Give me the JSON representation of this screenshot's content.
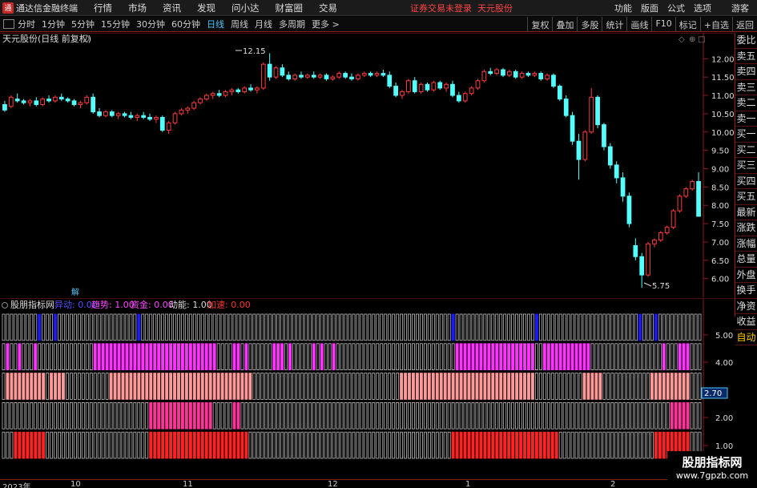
{
  "menubar": {
    "app_title": "通达信金融终端",
    "menus": [
      "行情",
      "市场",
      "资讯",
      "发现",
      "问小达",
      "财富圈",
      "交易"
    ],
    "login_status": "证券交易未登录",
    "stock_name_red": "天元股份",
    "right_menus": [
      "功能",
      "版面",
      "公式",
      "选项"
    ],
    "guest": "游客"
  },
  "periodbar": {
    "periods": [
      "分时",
      "1分钟",
      "5分钟",
      "15分钟",
      "30分钟",
      "60分钟",
      "日线",
      "周线",
      "月线",
      "多周期",
      "更多 >"
    ],
    "active_period": "日线",
    "tools": [
      "复权",
      "叠加",
      "多股",
      "统计",
      "画线",
      "F10",
      "标记",
      "+自选",
      "返回"
    ]
  },
  "main_chart": {
    "title": "天元股份(日线 前复权)",
    "annot_high": "12.15",
    "annot_low": "5.75",
    "marker": "解",
    "y_ticks": [
      "12.00",
      "11.50",
      "11.00",
      "10.50",
      "10.00",
      "9.50",
      "9.00",
      "8.50",
      "8.00",
      "7.50",
      "7.00",
      "6.50",
      "6.00"
    ]
  },
  "sub_chart": {
    "name": "股朋指标网",
    "params": [
      {
        "label": "异动: 0.00",
        "color": "#5050ff"
      },
      {
        "label": "趋势: 1.00",
        "color": "#ff44ff"
      },
      {
        "label": "资金: 0.00",
        "color": "#ff44ff"
      },
      {
        "label": "动能: 1.00",
        "color": "#dddddd"
      },
      {
        "label": "加速: 0.00",
        "color": "#ff3333"
      }
    ],
    "y_ticks": [
      "5.00",
      "4.00",
      "2.00",
      "1.00"
    ],
    "current_value": "2.70"
  },
  "date_axis": [
    "2023年",
    "10",
    "11",
    "12",
    "1",
    "2"
  ],
  "side_panel": [
    "委比",
    "卖五",
    "卖四",
    "卖三",
    "卖二",
    "卖一",
    "买一",
    "买二",
    "买三",
    "买四",
    "买五",
    "最新",
    "涨跌",
    "涨幅",
    "总量",
    "外盘",
    "换手",
    "净资",
    "收益",
    "自动"
  ],
  "watermark": {
    "line1": "股朋指标网",
    "line2": "www.7gpzb.com"
  },
  "chart_data": {
    "type": "candlestick",
    "title": "天元股份(日线 前复权)",
    "ylim": [
      5.6,
      12.4
    ],
    "candles": [
      [
        10.75,
        10.85,
        10.55,
        10.6
      ],
      [
        10.7,
        11.0,
        10.65,
        10.95
      ],
      [
        10.9,
        11.05,
        10.8,
        10.85
      ],
      [
        10.85,
        10.9,
        10.75,
        10.8
      ],
      [
        10.8,
        10.9,
        10.7,
        10.85
      ],
      [
        10.85,
        10.95,
        10.7,
        10.75
      ],
      [
        10.75,
        10.95,
        10.7,
        10.9
      ],
      [
        10.9,
        11.0,
        10.8,
        10.85
      ],
      [
        10.85,
        11.0,
        10.8,
        10.95
      ],
      [
        10.95,
        11.05,
        10.85,
        10.9
      ],
      [
        10.9,
        10.95,
        10.8,
        10.85
      ],
      [
        10.85,
        10.9,
        10.7,
        10.75
      ],
      [
        10.75,
        10.85,
        10.65,
        10.8
      ],
      [
        10.8,
        11.0,
        10.75,
        10.95
      ],
      [
        10.95,
        11.05,
        10.5,
        10.55
      ],
      [
        10.55,
        10.65,
        10.4,
        10.45
      ],
      [
        10.45,
        10.6,
        10.4,
        10.55
      ],
      [
        10.55,
        10.6,
        10.4,
        10.45
      ],
      [
        10.45,
        10.55,
        10.35,
        10.5
      ],
      [
        10.5,
        10.55,
        10.4,
        10.45
      ],
      [
        10.45,
        10.55,
        10.35,
        10.4
      ],
      [
        10.4,
        10.5,
        10.3,
        10.45
      ],
      [
        10.45,
        10.55,
        10.35,
        10.4
      ],
      [
        10.4,
        10.5,
        10.3,
        10.35
      ],
      [
        10.35,
        10.45,
        10.25,
        10.4
      ],
      [
        10.4,
        10.45,
        10.0,
        10.05
      ],
      [
        10.05,
        10.3,
        9.95,
        10.25
      ],
      [
        10.25,
        10.55,
        10.2,
        10.5
      ],
      [
        10.5,
        10.65,
        10.45,
        10.6
      ],
      [
        10.6,
        10.7,
        10.5,
        10.65
      ],
      [
        10.65,
        10.85,
        10.6,
        10.8
      ],
      [
        10.8,
        10.95,
        10.75,
        10.9
      ],
      [
        10.9,
        11.05,
        10.85,
        11.0
      ],
      [
        11.0,
        11.1,
        10.9,
        11.05
      ],
      [
        11.05,
        11.15,
        10.95,
        11.0
      ],
      [
        11.0,
        11.15,
        10.95,
        11.1
      ],
      [
        11.1,
        11.2,
        11.0,
        11.15
      ],
      [
        11.15,
        11.2,
        11.05,
        11.1
      ],
      [
        11.1,
        11.25,
        11.05,
        11.2
      ],
      [
        11.2,
        11.3,
        11.1,
        11.15
      ],
      [
        11.15,
        11.25,
        11.05,
        11.2
      ],
      [
        11.2,
        11.9,
        11.15,
        11.85
      ],
      [
        11.85,
        12.15,
        11.4,
        11.5
      ],
      [
        11.5,
        11.8,
        11.45,
        11.75
      ],
      [
        11.75,
        11.85,
        11.5,
        11.55
      ],
      [
        11.55,
        11.65,
        11.4,
        11.45
      ],
      [
        11.45,
        11.6,
        11.4,
        11.55
      ],
      [
        11.55,
        11.65,
        11.45,
        11.5
      ],
      [
        11.5,
        11.6,
        11.45,
        11.55
      ],
      [
        11.55,
        11.65,
        11.45,
        11.5
      ],
      [
        11.5,
        11.6,
        11.45,
        11.55
      ],
      [
        11.55,
        11.6,
        11.4,
        11.45
      ],
      [
        11.45,
        11.55,
        11.4,
        11.5
      ],
      [
        11.5,
        11.65,
        11.45,
        11.6
      ],
      [
        11.6,
        11.65,
        11.45,
        11.5
      ],
      [
        11.5,
        11.6,
        11.4,
        11.45
      ],
      [
        11.45,
        11.6,
        11.4,
        11.55
      ],
      [
        11.55,
        11.65,
        11.5,
        11.6
      ],
      [
        11.6,
        11.65,
        11.5,
        11.55
      ],
      [
        11.55,
        11.65,
        11.5,
        11.6
      ],
      [
        11.6,
        11.7,
        11.5,
        11.55
      ],
      [
        11.55,
        11.65,
        11.2,
        11.25
      ],
      [
        11.25,
        11.35,
        10.95,
        11.0
      ],
      [
        11.0,
        11.15,
        10.9,
        11.1
      ],
      [
        11.1,
        11.45,
        11.05,
        11.4
      ],
      [
        11.4,
        11.5,
        11.05,
        11.1
      ],
      [
        11.1,
        11.35,
        11.05,
        11.3
      ],
      [
        11.3,
        11.35,
        11.1,
        11.15
      ],
      [
        11.15,
        11.4,
        11.1,
        11.35
      ],
      [
        11.35,
        11.4,
        11.15,
        11.2
      ],
      [
        11.2,
        11.35,
        11.1,
        11.3
      ],
      [
        11.3,
        11.4,
        10.95,
        11.0
      ],
      [
        11.0,
        11.1,
        10.8,
        10.85
      ],
      [
        10.85,
        11.1,
        10.8,
        11.05
      ],
      [
        11.05,
        11.25,
        11.0,
        11.2
      ],
      [
        11.2,
        11.45,
        11.15,
        11.4
      ],
      [
        11.4,
        11.7,
        11.35,
        11.65
      ],
      [
        11.65,
        11.75,
        11.55,
        11.6
      ],
      [
        11.6,
        11.75,
        11.55,
        11.7
      ],
      [
        11.7,
        11.75,
        11.5,
        11.55
      ],
      [
        11.55,
        11.7,
        11.5,
        11.65
      ],
      [
        11.65,
        11.7,
        11.45,
        11.5
      ],
      [
        11.5,
        11.65,
        11.45,
        11.6
      ],
      [
        11.6,
        11.65,
        11.5,
        11.55
      ],
      [
        11.55,
        11.65,
        11.5,
        11.6
      ],
      [
        11.6,
        11.65,
        11.4,
        11.45
      ],
      [
        11.45,
        11.6,
        11.4,
        11.55
      ],
      [
        11.55,
        11.6,
        11.2,
        11.25
      ],
      [
        11.25,
        11.3,
        10.85,
        10.9
      ],
      [
        10.9,
        11.0,
        10.4,
        10.45
      ],
      [
        10.45,
        10.55,
        9.65,
        9.75
      ],
      [
        9.75,
        9.95,
        8.7,
        9.25
      ],
      [
        9.25,
        10.05,
        9.2,
        10.0
      ],
      [
        10.0,
        11.2,
        9.95,
        10.95
      ],
      [
        10.95,
        11.0,
        10.1,
        10.2
      ],
      [
        10.2,
        10.25,
        9.5,
        9.6
      ],
      [
        9.6,
        9.7,
        9.0,
        9.1
      ],
      [
        9.1,
        9.2,
        8.6,
        8.75
      ],
      [
        8.75,
        8.9,
        8.1,
        8.25
      ],
      [
        8.25,
        8.35,
        7.4,
        7.5
      ],
      [
        6.9,
        7.1,
        6.5,
        6.6
      ],
      [
        6.6,
        6.7,
        5.75,
        6.1
      ],
      [
        6.1,
        7.0,
        6.05,
        6.95
      ],
      [
        6.95,
        7.1,
        6.85,
        7.05
      ],
      [
        7.05,
        7.3,
        7.0,
        7.25
      ],
      [
        7.25,
        7.45,
        7.2,
        7.4
      ],
      [
        7.4,
        7.9,
        7.35,
        7.85
      ],
      [
        7.85,
        8.3,
        7.8,
        8.25
      ],
      [
        8.25,
        8.5,
        8.2,
        8.45
      ],
      [
        8.45,
        8.7,
        8.4,
        8.65
      ],
      [
        8.65,
        8.9,
        7.7,
        7.7
      ]
    ],
    "indicator_rows": [
      {
        "name": "异动",
        "color": "#1a1aff",
        "filled": [
          9,
          13,
          34,
          113,
          134,
          160,
          164
        ]
      },
      {
        "name": "趋势",
        "color": "#ff33ff",
        "filled": [
          1,
          4,
          8,
          23,
          24,
          25,
          26,
          27,
          28,
          29,
          30,
          31,
          32,
          33,
          34,
          35,
          36,
          37,
          38,
          39,
          40,
          41,
          42,
          43,
          44,
          45,
          46,
          47,
          48,
          49,
          50,
          51,
          52,
          53,
          58,
          59,
          61,
          68,
          69,
          70,
          72,
          78,
          80,
          83,
          114,
          115,
          116,
          117,
          118,
          119,
          120,
          121,
          122,
          123,
          124,
          125,
          126,
          127,
          128,
          129,
          130,
          131,
          132,
          133,
          136,
          137,
          138,
          139,
          140,
          141,
          142,
          143,
          144,
          145,
          146,
          147,
          166,
          170,
          171,
          172
        ]
      },
      {
        "name": "资金",
        "color": "#ff9999",
        "filled": [
          1,
          2,
          3,
          4,
          5,
          6,
          7,
          8,
          9,
          10,
          12,
          13,
          14,
          15,
          27,
          28,
          29,
          30,
          31,
          32,
          33,
          34,
          35,
          36,
          37,
          38,
          39,
          40,
          41,
          42,
          43,
          44,
          45,
          46,
          47,
          48,
          49,
          50,
          51,
          52,
          53,
          54,
          55,
          56,
          57,
          58,
          59,
          60,
          61,
          62,
          100,
          101,
          102,
          103,
          104,
          105,
          106,
          107,
          108,
          109,
          110,
          111,
          112,
          113,
          114,
          115,
          116,
          117,
          118,
          119,
          120,
          121,
          122,
          123,
          124,
          125,
          126,
          127,
          128,
          129,
          130,
          131,
          132,
          133,
          146,
          147,
          148,
          149,
          150,
          163,
          164,
          165,
          166,
          167,
          168,
          169,
          170,
          171,
          172
        ]
      },
      {
        "name": "动能",
        "color": "#ff3399",
        "filled": [
          37,
          38,
          39,
          40,
          41,
          42,
          43,
          44,
          45,
          46,
          47,
          48,
          49,
          50,
          51,
          52,
          58,
          59,
          168,
          169,
          170,
          171,
          172
        ]
      },
      {
        "name": "加速",
        "color": "#ff2222",
        "filled": [
          3,
          4,
          5,
          6,
          7,
          8,
          9,
          10,
          37,
          38,
          39,
          40,
          41,
          42,
          43,
          44,
          45,
          46,
          47,
          48,
          49,
          50,
          51,
          52,
          53,
          54,
          55,
          56,
          57,
          58,
          59,
          60,
          61,
          113,
          114,
          115,
          116,
          117,
          118,
          119,
          120,
          121,
          122,
          123,
          124,
          125,
          126,
          127,
          128,
          129,
          130,
          131,
          132,
          133,
          134,
          135,
          136,
          137,
          138,
          139,
          164,
          165,
          166,
          167,
          168,
          169,
          170,
          171,
          172
        ]
      }
    ],
    "indicator_bar_count": 176
  }
}
